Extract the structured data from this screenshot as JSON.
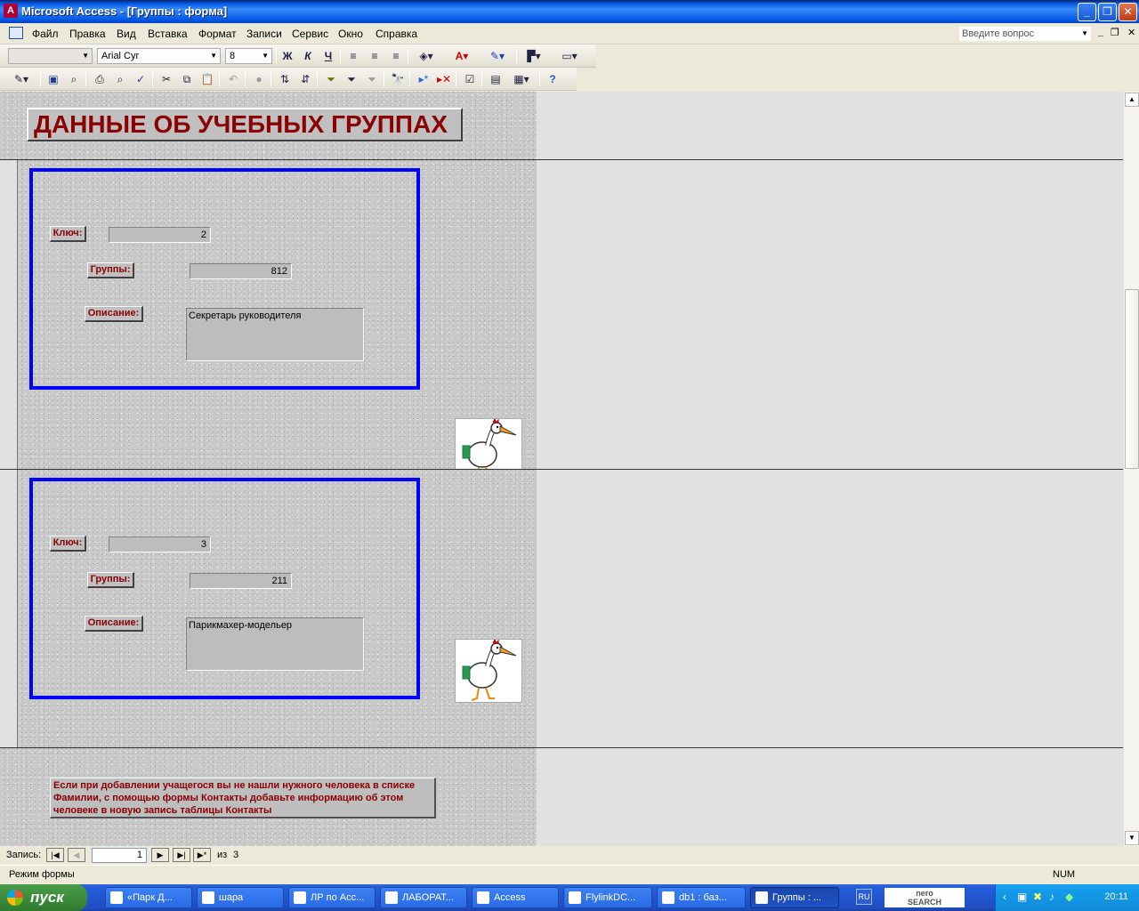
{
  "window": {
    "title": "Microsoft Access - [Группы : форма]",
    "minimize": "_",
    "restore": "❐",
    "close": "✕"
  },
  "menu": {
    "items": [
      "Файл",
      "Правка",
      "Вид",
      "Вставка",
      "Формат",
      "Записи",
      "Сервис",
      "Окно",
      "Справка"
    ],
    "ask_placeholder": "Введите вопрос"
  },
  "toolbar": {
    "font_name": "Arial Cyr",
    "font_size": "8"
  },
  "form": {
    "header_title": "ДАННЫЕ ОБ УЧЕБНЫХ ГРУППАХ",
    "labels": {
      "key": "Ключ:",
      "group": "Группы:",
      "description": "Описание:"
    },
    "records": [
      {
        "key": "2",
        "group": "812",
        "description": "Секретарь руководителя"
      },
      {
        "key": "3",
        "group": "211",
        "description": "Парикмахер-модельер"
      }
    ],
    "footer_note": "Если при добавлении учащегося вы не нашли нужного человека в списке Фамилии, с помощью формы Контакты добавьте информацию об этом человеке в новую запись таблицы Контакты"
  },
  "navigation": {
    "label": "Запись:",
    "current": "1",
    "of_label": "из",
    "total": "3"
  },
  "status": {
    "mode": "Режим формы",
    "num": "NUM"
  },
  "taskbar": {
    "start_label": "пуск",
    "tasks": [
      "«Парк Д...",
      "шара",
      "ЛР по Acc...",
      "ЛАБОРАТ...",
      "Access",
      "FlylinkDC...",
      "db1 : баз...",
      "Группы : ..."
    ],
    "lang": "RU",
    "nero_top": "nero",
    "nero_bottom": "SEARCH",
    "clock": "20:11"
  }
}
